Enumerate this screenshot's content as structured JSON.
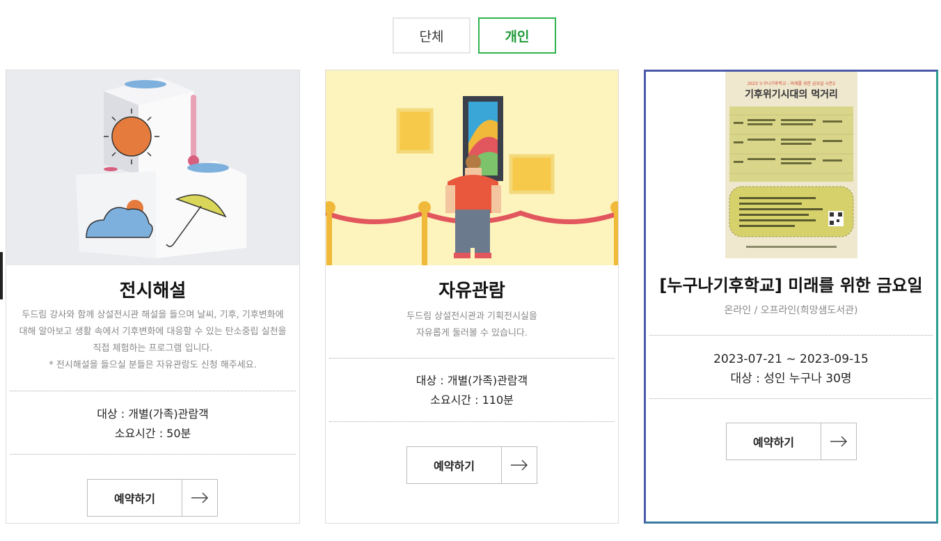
{
  "tabs": [
    {
      "label": "단체",
      "active": false
    },
    {
      "label": "개인",
      "active": true
    }
  ],
  "cards": [
    {
      "title": "전시해설",
      "description": [
        "두드림 강사와 함께 상설전시관 해설을 들으며 날씨, 기후, 기후변화에",
        "대해 알아보고 생활 속에서 기후변화에 대응할 수 있는 탄소중립 실천을",
        "직접 체험하는 프로그램 입니다.",
        "* 전시해설을 들으실 분들은 자유관람도 신청 해주세요."
      ],
      "target": "대상 : 개별(가족)관람객",
      "duration": "소요시간 : 50분",
      "button": "예약하기",
      "image": "weather-cubes-illustration"
    },
    {
      "title": "자유관람",
      "description": [
        "두드림 상설전시관과 기획전시실을",
        "자유롭게 둘러볼 수 있습니다."
      ],
      "target": "대상 : 개별(가족)관람객",
      "duration": "소요시간 : 110분",
      "button": "예약하기",
      "image": "gallery-visitor-illustration"
    },
    {
      "title": "[누구나기후학교] 미래를 위한 금요일",
      "subtitle": "온라인 / 오프라인(희망샘도서관)",
      "period": "2023-07-21 ~ 2023-09-15",
      "target": "대상 : 성인 누구나 30명",
      "button": "예약하기",
      "poster": {
        "top_text": "2023 누구나기후학교 - 미래를 위한 금요일 시즌2",
        "headline": "기후위기시대의 먹거리"
      }
    }
  ],
  "colors": {
    "accent_green": "#2db34a",
    "card3_border": "#2a9d8f"
  }
}
